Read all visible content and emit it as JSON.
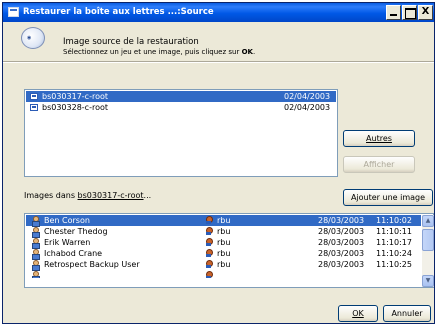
{
  "window": {
    "title": "Restaurer la boîte aux lettres ...:Source",
    "controls": {
      "minimize": "",
      "maximize": "",
      "close": "X"
    }
  },
  "header": {
    "title": "Image source de la restauration",
    "subtitle_prefix": "Sélectionnez un jeu et une image, puis cliquez sur ",
    "subtitle_bold": "OK",
    "subtitle_suffix": "."
  },
  "sets": [
    {
      "name": "bs030317-c-root",
      "date": "02/04/2003",
      "selected": true
    },
    {
      "name": "bs030328-c-root",
      "date": "02/04/2003",
      "selected": false
    }
  ],
  "buttons": {
    "autres": "Autres",
    "afficher": "Afficher",
    "ajouter": "Ajouter une image",
    "ok": "OK",
    "annuler": "Annuler"
  },
  "images_label": {
    "prefix": "Images dans ",
    "link": "bs030317-c-root",
    "suffix": "..."
  },
  "images": [
    {
      "name": "Ben Corson",
      "owner": "rbu",
      "date": "28/03/2003",
      "time": "11:10:02",
      "selected": true
    },
    {
      "name": "Chester Thedog",
      "owner": "rbu",
      "date": "28/03/2003",
      "time": "11:10:11",
      "selected": false
    },
    {
      "name": "Erik Warren",
      "owner": "rbu",
      "date": "28/03/2003",
      "time": "11:10:17",
      "selected": false
    },
    {
      "name": "Ichabod Crane",
      "owner": "rbu",
      "date": "28/03/2003",
      "time": "11:10:24",
      "selected": false
    },
    {
      "name": "Retrospect Backup User",
      "owner": "rbu",
      "date": "28/03/2003",
      "time": "11:10:25",
      "selected": false
    }
  ],
  "scroll": {
    "up": "▲",
    "down": "▼"
  }
}
